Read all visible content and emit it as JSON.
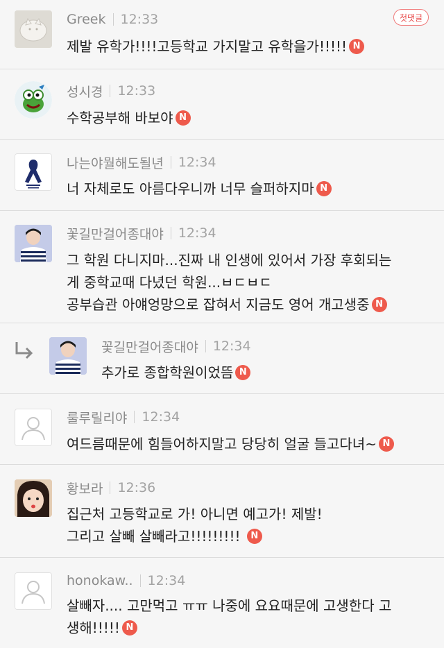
{
  "new_badge": "N",
  "comments": [
    {
      "author": "Greek",
      "time": "12:33",
      "first_label": "첫댓글",
      "body_lines": [
        "제발 유학가!!!!고등학교 가지말고 유학을가!!!!!"
      ],
      "avatar_icon": "cat-plate-icon"
    },
    {
      "author": "성시경",
      "time": "12:33",
      "body_lines": [
        "수학공부해 바보야"
      ],
      "avatar_icon": "frog-icon"
    },
    {
      "author": "나는야뭘해도될년",
      "time": "12:34",
      "body_lines": [
        "너 자체로도 아름다우니까 너무 슬퍼하지마"
      ],
      "avatar_icon": "ribbon-icon"
    },
    {
      "author": "꽃길만걸어종대야",
      "time": "12:34",
      "body_lines": [
        "그 학원 다니지마...진짜 내 인생에 있어서 가장 후회되는",
        "게 중학교때 다녔던 학원...ㅂㄷㅂㄷ",
        "공부습관 아얘엉망으로 잡혀서 지금도 영어 개고생중"
      ],
      "avatar_icon": "person-striped-shirt-icon"
    },
    {
      "author": "꽃길만걸어종대야",
      "time": "12:34",
      "is_reply": true,
      "body_lines": [
        "추가로 종합학원이었뜸"
      ],
      "avatar_icon": "person-striped-shirt-icon"
    },
    {
      "author": "룰루릴리야",
      "time": "12:34",
      "body_lines": [
        "여드름때문에 힘들어하지말고 당당히 얼굴 들고다녀~"
      ],
      "avatar_icon": "default-user-icon"
    },
    {
      "author": "황보라",
      "time": "12:36",
      "body_lines": [
        "집근처 고등학교로 가! 아니면 예고가! 제발!",
        "그리고 살빼 살빼라고!!!!!!!!! "
      ],
      "avatar_icon": "girl-face-icon"
    },
    {
      "author": "honokaw..",
      "time": "12:34",
      "body_lines": [
        "살빼자.... 고만먹고 ㅠㅠ 나중에 요요때문에 고생한다 고",
        "생해!!!!!"
      ],
      "avatar_icon": "default-user-icon"
    }
  ]
}
